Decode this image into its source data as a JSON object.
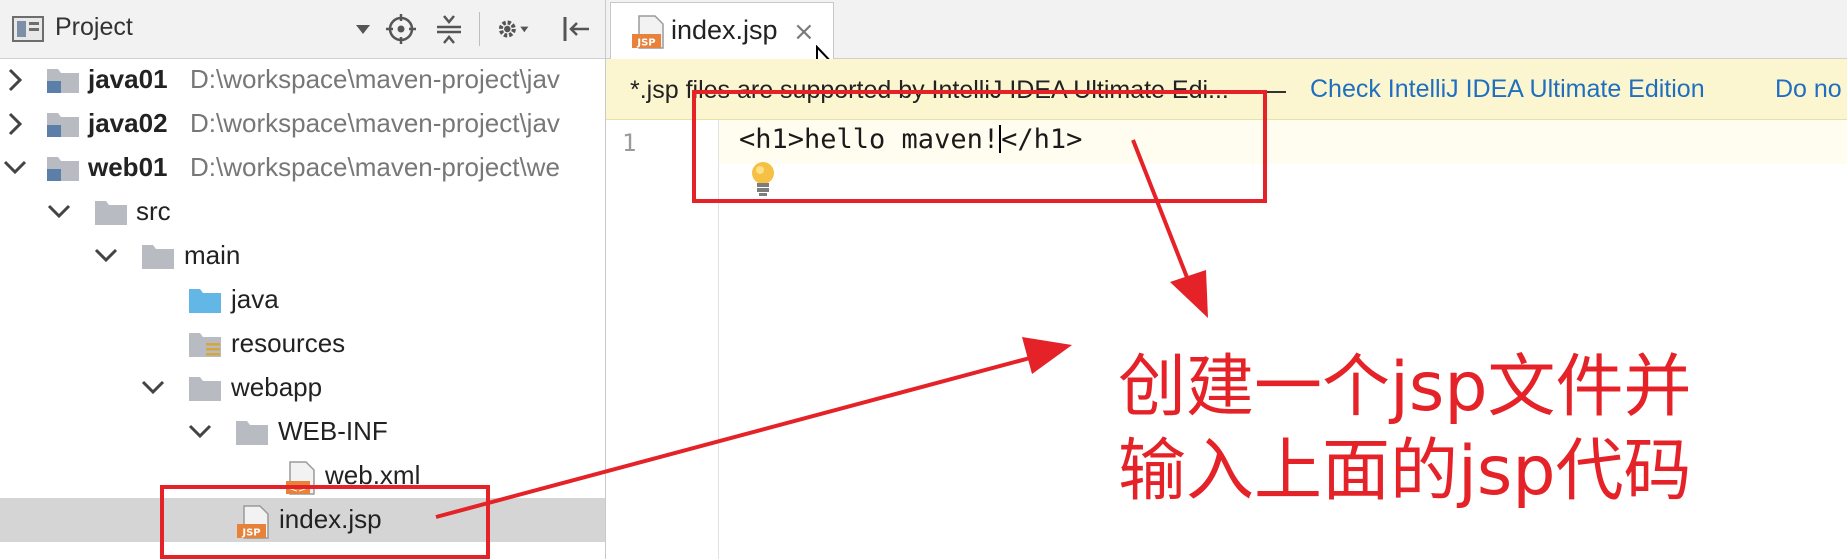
{
  "project_panel": {
    "title": "Project",
    "tree": [
      {
        "label": "java01",
        "path": "D:\\workspace\\maven-project\\jav",
        "bold": true,
        "arrow": "right",
        "icon": "module"
      },
      {
        "label": "java02",
        "path": "D:\\workspace\\maven-project\\jav",
        "bold": true,
        "arrow": "right",
        "icon": "module"
      },
      {
        "label": "web01",
        "path": "D:\\workspace\\maven-project\\we",
        "bold": true,
        "arrow": "down",
        "icon": "module"
      },
      {
        "label": "src",
        "arrow": "down",
        "icon": "folder"
      },
      {
        "label": "main",
        "arrow": "down",
        "icon": "folder"
      },
      {
        "label": "java",
        "icon": "source-folder"
      },
      {
        "label": "resources",
        "icon": "resources-folder"
      },
      {
        "label": "webapp",
        "arrow": "down",
        "icon": "folder"
      },
      {
        "label": "WEB-INF",
        "arrow": "down",
        "icon": "folder"
      },
      {
        "label": "web.xml",
        "icon": "xml-file"
      },
      {
        "label": "index.jsp",
        "icon": "jsp-file",
        "selected": true
      }
    ]
  },
  "editor": {
    "tab": {
      "label": "index.jsp",
      "close": "×"
    },
    "banner": {
      "message": "*.jsp files are supported by IntelliJ IDEA Ultimate Edi...",
      "link_check": "Check IntelliJ IDEA Ultimate Edition",
      "link_dismiss": "Do no"
    },
    "line_number": "1",
    "code_before_caret": "<h1>hello maven!",
    "code_after_caret": "</h1>"
  },
  "annotation": {
    "line1": "创建一个jsp文件并",
    "line2": "输入上面的jsp代码",
    "color": "#e42228"
  }
}
